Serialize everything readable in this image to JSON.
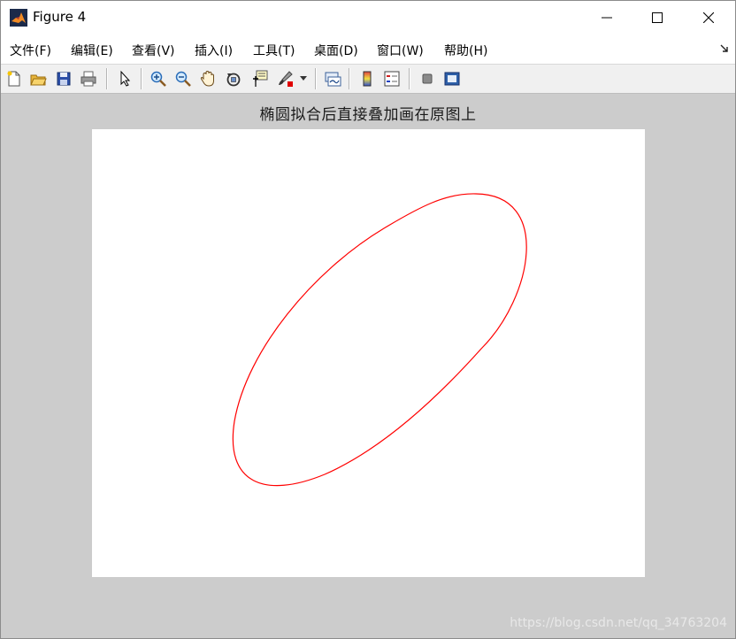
{
  "window": {
    "title": "Figure 4",
    "controls": [
      "minimize",
      "maximize",
      "close"
    ]
  },
  "menu": {
    "items": [
      {
        "label": "文件(F)",
        "name": "menu-file"
      },
      {
        "label": "编辑(E)",
        "name": "menu-edit"
      },
      {
        "label": "查看(V)",
        "name": "menu-view"
      },
      {
        "label": "插入(I)",
        "name": "menu-insert"
      },
      {
        "label": "工具(T)",
        "name": "menu-tools"
      },
      {
        "label": "桌面(D)",
        "name": "menu-desktop"
      },
      {
        "label": "窗口(W)",
        "name": "menu-window"
      },
      {
        "label": "帮助(H)",
        "name": "menu-help"
      }
    ]
  },
  "toolbar": {
    "icons": [
      "new-figure-icon",
      "open-file-icon",
      "save-icon",
      "print-icon",
      "edit-plot-arrow-icon",
      "zoom-in-icon",
      "zoom-out-icon",
      "pan-hand-icon",
      "rotate-3d-icon",
      "data-cursor-icon",
      "brush-icon",
      "brush-dropdown-icon",
      "link-plot-icon",
      "colorbar-icon",
      "legend-icon",
      "hide-plot-tools-icon",
      "show-plot-tools-icon"
    ]
  },
  "figure": {
    "title": "椭圆拟合后直接叠加画在原图上",
    "ellipse_color": "#ff0000",
    "background_color": "#cccccc"
  },
  "watermark": "https://blog.csdn.net/qq_34763204"
}
